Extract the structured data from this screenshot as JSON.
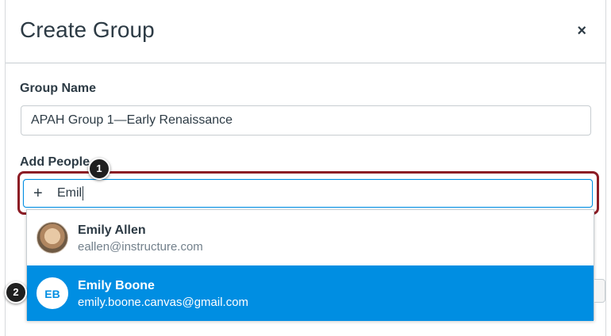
{
  "dialog": {
    "title": "Create Group",
    "close_label": "×"
  },
  "form": {
    "group_name_label": "Group Name",
    "group_name_value": "APAH Group 1—Early Renaissance",
    "add_people_label": "Add People",
    "add_people_icon": "+",
    "add_people_value": "Emil"
  },
  "callouts": {
    "one": "1",
    "two": "2"
  },
  "suggestions": [
    {
      "name": "Emily Allen",
      "email": "eallen@instructure.com",
      "avatar": "photo"
    },
    {
      "name": "Emily Boone",
      "email": "emily.boone.canvas@gmail.com",
      "initials": "EB",
      "selected": true
    }
  ],
  "colors": {
    "accent": "#008ee2",
    "highlight_border": "#8c1c25",
    "text": "#2d3b45",
    "muted": "#73818c"
  }
}
